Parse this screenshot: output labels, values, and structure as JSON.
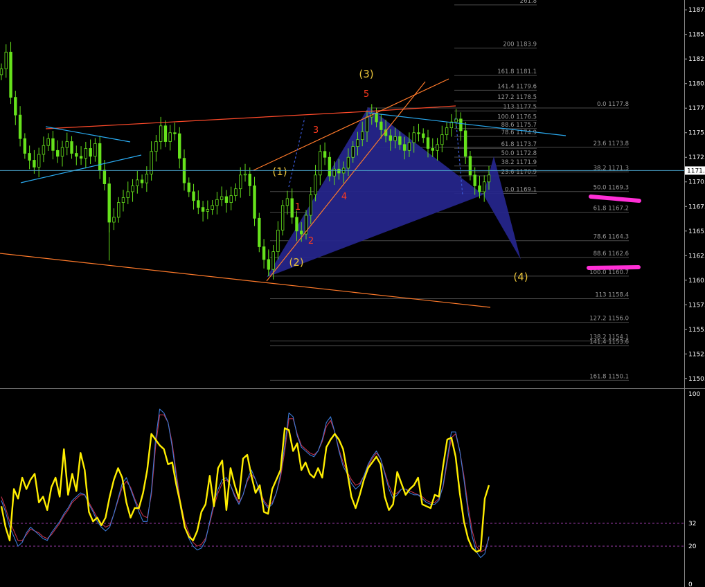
{
  "chart_data": [
    {
      "type": "candlestick",
      "panel": "price",
      "ylim": [
        1149.0,
        1188.5
      ],
      "current_price": "1171.",
      "colors": {
        "background": "#000000",
        "bull_candle": "#66e21c",
        "bear_candle": "#66e21c",
        "axis_text": "#ffffff",
        "fib_line": "#4a4a4a",
        "fib_text": "#9a9a9a",
        "pattern_fill": "#25258a",
        "wave_label_primary": "#e8c23a",
        "wave_label_minor": "#ff3b1f",
        "trendline_orange": "#ff7a2a",
        "trendline_red": "#ff4a2a",
        "trendline_cyan": "#2aaaf0",
        "target_marker": "#ff2fd6",
        "price_line": "#4aa3c9"
      },
      "y_ticks": [
        "1187.",
        "1185.",
        "1182.",
        "1180.",
        "1177.",
        "1175.",
        "1172.",
        "1170.",
        "1167.",
        "1165.",
        "1162.",
        "1160.",
        "1157.",
        "1155.",
        "1152.",
        "1150."
      ],
      "y_tick_values": [
        1187.5,
        1185.0,
        1182.5,
        1180.0,
        1177.5,
        1175.0,
        1172.5,
        1170.0,
        1167.5,
        1165.0,
        1162.5,
        1160.0,
        1157.5,
        1155.0,
        1152.5,
        1150.0
      ],
      "close_series": [
        1181.5,
        1183.2,
        1178.6,
        1176.8,
        1174.4,
        1172.9,
        1172.2,
        1171.5,
        1172.8,
        1173.7,
        1174.4,
        1173.2,
        1172.6,
        1173.5,
        1174.1,
        1172.9,
        1172.6,
        1172.4,
        1173.4,
        1172.6,
        1173.9,
        1171.2,
        1169.8,
        1165.9,
        1166.4,
        1167.9,
        1168.4,
        1169.0,
        1169.6,
        1170.2,
        1169.9,
        1170.8,
        1173.1,
        1174.1,
        1175.7,
        1174.1,
        1175.0,
        1174.9,
        1172.4,
        1169.9,
        1169.0,
        1168.1,
        1167.4,
        1167.0,
        1167.2,
        1167.6,
        1168.2,
        1168.5,
        1167.9,
        1168.6,
        1169.3,
        1170.7,
        1170.8,
        1169.6,
        1166.3,
        1163.4,
        1162.1,
        1161.1,
        1162.9,
        1165.1,
        1167.6,
        1168.3,
        1166.4,
        1165.0,
        1164.7,
        1166.6,
        1168.7,
        1170.7,
        1173.1,
        1172.5,
        1170.6,
        1171.3,
        1170.9,
        1171.4,
        1172.5,
        1173.6,
        1174.3,
        1175.1,
        1176.6,
        1177.0,
        1176.1,
        1175.3,
        1174.7,
        1174.2,
        1174.6,
        1173.8,
        1173.2,
        1174.0,
        1175.0,
        1174.9,
        1174.5,
        1173.4,
        1173.2,
        1173.8,
        1174.8,
        1175.5,
        1176.1,
        1176.4,
        1175.2,
        1172.6,
        1170.7,
        1169.6,
        1169.0,
        1170.0,
        1170.7
      ],
      "y_labels_text": [],
      "fibonacci_levels": [
        {
          "label": "261.8"
        },
        {
          "label": "200 1183.9",
          "value": 1183.9
        },
        {
          "label": "161.8 1181.1",
          "value": 1181.1
        },
        {
          "label": "141.4 1179.6",
          "value": 1179.6
        },
        {
          "label": "127.2 1178.5",
          "value": 1178.5
        },
        {
          "label": "113 1177.5",
          "value": 1177.5
        },
        {
          "label": "100.0 1176.5",
          "value": 1176.5
        },
        {
          "label": "88.6 1175.7",
          "value": 1175.7
        },
        {
          "label": "78.6 1174.9",
          "value": 1174.9
        },
        {
          "label": "61.8 1173.7",
          "value": 1173.7
        },
        {
          "label": "50.0 1172.8",
          "value": 1172.8
        },
        {
          "label": "38.2 1171.9",
          "value": 1171.9
        },
        {
          "label": "23.6 1170.9",
          "value": 1170.9
        },
        {
          "label": "0.0 1169.1",
          "value": 1169.1
        },
        {
          "label": "0.0 1177.8",
          "value": 1177.8
        },
        {
          "label": "23.6 1173.8",
          "value": 1173.8
        },
        {
          "label": "38.2 1171.3",
          "value": 1171.3
        },
        {
          "label": "50.0 1169.3",
          "value": 1169.3
        },
        {
          "label": "61.8 1167.2",
          "value": 1167.2
        },
        {
          "label": "78.6 1164.3",
          "value": 1164.3
        },
        {
          "label": "88.6 1162.6",
          "value": 1162.6
        },
        {
          "label": "100.0 1160.7",
          "value": 1160.7
        },
        {
          "label": "113 1158.4",
          "value": 1158.4
        },
        {
          "label": "127.2 1156.0",
          "value": 1156.0
        },
        {
          "label": "138.2 1154.1",
          "value": 1154.1
        },
        {
          "label": "141.4 1153.6",
          "value": 1153.6
        },
        {
          "label": "161.8 1150.1",
          "value": 1150.1
        }
      ],
      "wave_labels": [
        {
          "text": "(1)",
          "kind": "primary"
        },
        {
          "text": "(2)",
          "kind": "primary"
        },
        {
          "text": "(3)",
          "kind": "primary"
        },
        {
          "text": "(4)",
          "kind": "primary"
        },
        {
          "text": "1",
          "kind": "minor"
        },
        {
          "text": "2",
          "kind": "minor"
        },
        {
          "text": "3",
          "kind": "minor"
        },
        {
          "text": "4",
          "kind": "minor"
        },
        {
          "text": "5",
          "kind": "minor"
        }
      ]
    },
    {
      "type": "line",
      "panel": "oscillator",
      "ylim": [
        0,
        100
      ],
      "y_ticks": [
        "100",
        "32",
        "20",
        "0"
      ],
      "y_tick_values": [
        100,
        32,
        20,
        0
      ],
      "levels": [
        32,
        20
      ],
      "series": [
        {
          "color": "#ffee00",
          "values": [
            41,
            30,
            23,
            50,
            45,
            56,
            50,
            55,
            58,
            43,
            46,
            39,
            51,
            56,
            46,
            71,
            47,
            58,
            49,
            69,
            60,
            38,
            33,
            35,
            31,
            35,
            46,
            55,
            61,
            56,
            43,
            35,
            40,
            40,
            48,
            60,
            79,
            76,
            73,
            71,
            63,
            64,
            52,
            42,
            30,
            25,
            23,
            28,
            38,
            42,
            57,
            41,
            61,
            65,
            39,
            61,
            52,
            45,
            66,
            68,
            57,
            48,
            52,
            38,
            37,
            50,
            55,
            60,
            82,
            81,
            70,
            74,
            60,
            64,
            58,
            56,
            61,
            56,
            72,
            76,
            79,
            76,
            71,
            59,
            46,
            40,
            47,
            55,
            61,
            64,
            67,
            63,
            46,
            39,
            42,
            59,
            53,
            47,
            50,
            52,
            56,
            42,
            41,
            40,
            47,
            46,
            62,
            76,
            77,
            67,
            48,
            33,
            24,
            19,
            17,
            18,
            45,
            52
          ]
        },
        {
          "color": "#3a7ad8",
          "values": [
            44,
            38,
            30,
            25,
            20,
            22,
            27,
            30,
            28,
            26,
            24,
            23,
            27,
            30,
            33,
            37,
            40,
            44,
            46,
            48,
            47,
            42,
            38,
            33,
            30,
            28,
            30,
            37,
            45,
            53,
            56,
            50,
            44,
            38,
            33,
            33,
            49,
            76,
            92,
            90,
            85,
            72,
            56,
            40,
            30,
            24,
            20,
            18,
            19,
            23,
            33,
            43,
            50,
            55,
            56,
            52,
            46,
            42,
            47,
            55,
            60,
            55,
            48,
            43,
            40,
            42,
            48,
            58,
            73,
            90,
            88,
            78,
            72,
            70,
            68,
            67,
            70,
            76,
            85,
            88,
            80,
            70,
            62,
            58,
            53,
            50,
            52,
            57,
            63,
            67,
            70,
            66,
            58,
            50,
            45,
            47,
            50,
            50,
            48,
            47,
            47,
            45,
            43,
            42,
            42,
            44,
            52,
            66,
            80,
            80,
            70,
            55,
            38,
            25,
            17,
            14,
            16,
            25
          ]
        },
        {
          "color": "#c0304a",
          "values": [
            46,
            40,
            33,
            28,
            23,
            23,
            26,
            29,
            28,
            27,
            25,
            24,
            26,
            29,
            32,
            36,
            39,
            43,
            45,
            47,
            47,
            43,
            39,
            35,
            32,
            30,
            31,
            37,
            44,
            51,
            54,
            51,
            45,
            40,
            36,
            35,
            47,
            72,
            89,
            89,
            85,
            74,
            58,
            43,
            33,
            27,
            22,
            20,
            21,
            24,
            32,
            41,
            48,
            53,
            55,
            52,
            47,
            43,
            47,
            54,
            58,
            55,
            49,
            44,
            41,
            43,
            48,
            56,
            70,
            87,
            87,
            79,
            73,
            71,
            69,
            68,
            70,
            75,
            83,
            86,
            80,
            71,
            64,
            59,
            55,
            52,
            53,
            57,
            62,
            66,
            69,
            66,
            59,
            52,
            47,
            48,
            50,
            50,
            49,
            48,
            47,
            46,
            44,
            43,
            43,
            45,
            51,
            64,
            77,
            79,
            70,
            57,
            41,
            28,
            20,
            17,
            18,
            24
          ]
        }
      ]
    }
  ]
}
